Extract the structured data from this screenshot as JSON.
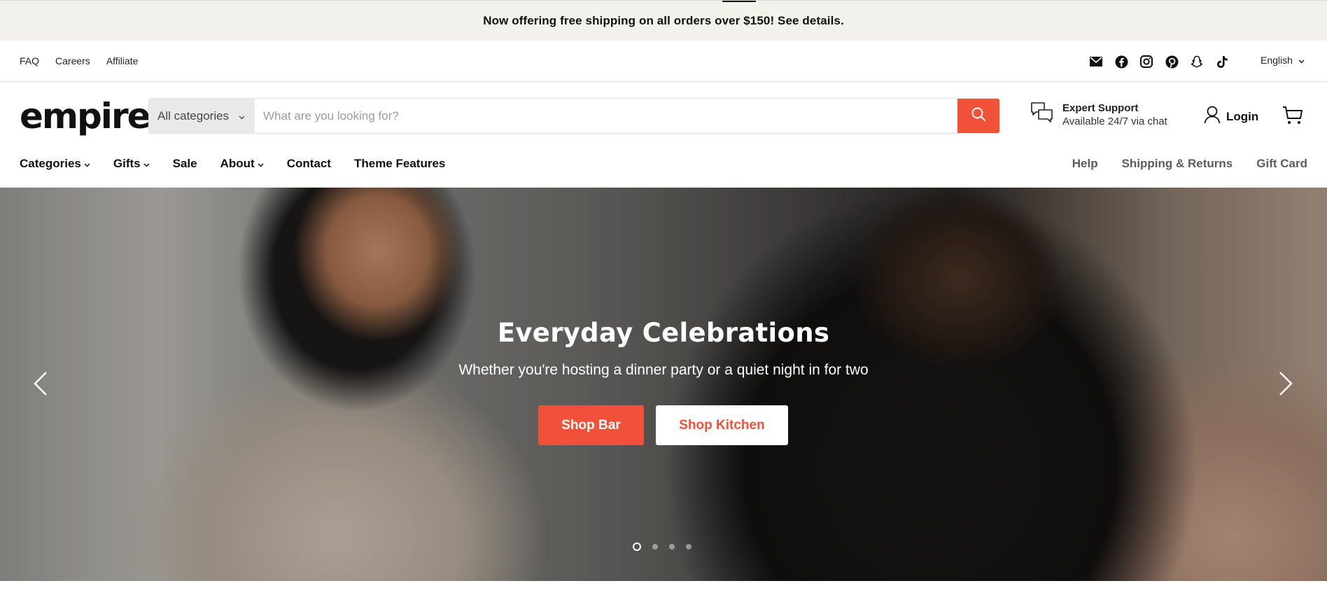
{
  "announcement": {
    "text": "Now offering free shipping on all orders over $150! See details."
  },
  "utility": {
    "links": [
      "FAQ",
      "Careers",
      "Affiliate"
    ],
    "social": [
      "email-icon",
      "facebook-icon",
      "instagram-icon",
      "pinterest-icon",
      "snapchat-icon",
      "tiktok-icon"
    ],
    "language": "English"
  },
  "header": {
    "logo": "empire",
    "search": {
      "category": "All categories",
      "placeholder": "What are you looking for?",
      "value": ""
    },
    "support": {
      "title": "Expert Support",
      "subtitle": "Available 24/7 via chat"
    },
    "login": "Login"
  },
  "nav": {
    "main": [
      {
        "label": "Categories",
        "dropdown": true
      },
      {
        "label": "Gifts",
        "dropdown": true
      },
      {
        "label": "Sale",
        "dropdown": false
      },
      {
        "label": "About",
        "dropdown": true
      },
      {
        "label": "Contact",
        "dropdown": false
      },
      {
        "label": "Theme Features",
        "dropdown": false
      }
    ],
    "secondary": [
      "Help",
      "Shipping & Returns",
      "Gift Card"
    ]
  },
  "hero": {
    "title": "Everyday Celebrations",
    "subtitle": "Whether you're hosting a dinner party or a quiet night in for two",
    "primary_button": "Shop Bar",
    "secondary_button": "Shop Kitchen",
    "slides_total": 4,
    "active_slide": 1
  },
  "colors": {
    "accent": "#f05138",
    "announcement_bg": "#f3f1ec"
  }
}
